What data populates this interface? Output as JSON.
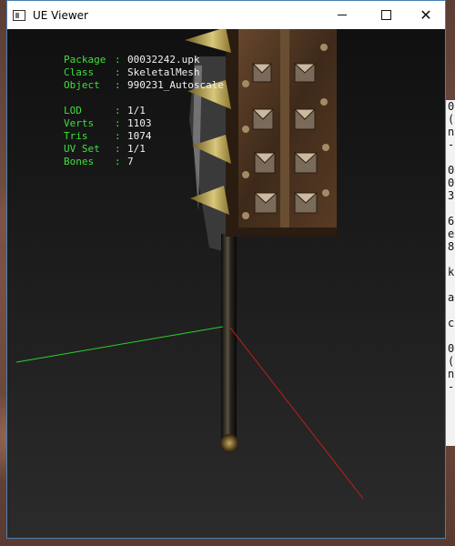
{
  "window": {
    "title": "UE Viewer",
    "controls": {
      "minimize": "minimize",
      "maximize": "maximize",
      "close": "✕"
    }
  },
  "info": {
    "package": {
      "label": "Package",
      "value": "00032242.upk"
    },
    "class": {
      "label": "Class",
      "value": "SkeletalMesh"
    },
    "object": {
      "label": "Object",
      "value": "990231_Autoscale"
    },
    "lod": {
      "label": "LOD",
      "value": "1/1"
    },
    "verts": {
      "label": "Verts",
      "value": "1103"
    },
    "tris": {
      "label": "Tris",
      "value": "1074"
    },
    "uvset": {
      "label": "UV Set",
      "value": "1/1"
    },
    "bones": {
      "label": "Bones",
      "value": "7"
    },
    "separator": ":"
  },
  "axes": {
    "x_color": "#2ccf2c",
    "y_color": "#c21d1d"
  },
  "background_window": {
    "glyphs": [
      "0",
      "(",
      "n",
      "-",
      "",
      "0",
      "0",
      "3",
      "",
      "6",
      "e",
      "8",
      "",
      "k",
      "",
      "a",
      "",
      "c",
      "",
      "0",
      "(",
      "n",
      "-"
    ]
  }
}
